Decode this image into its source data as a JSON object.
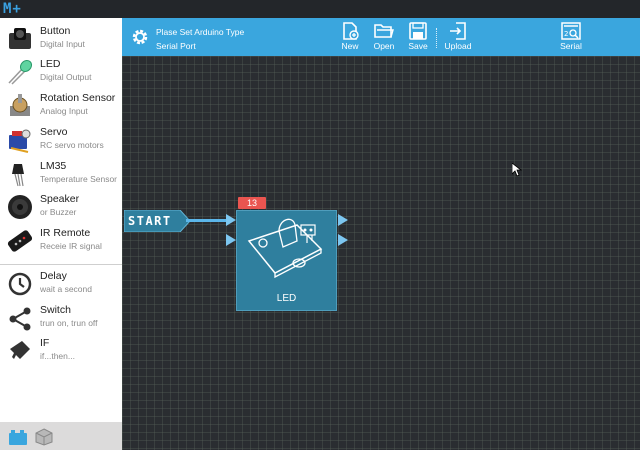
{
  "app": {
    "logo": "M+"
  },
  "sidebar": {
    "components": [
      {
        "name": "Button",
        "sub": "Digital Input",
        "icon": "button-module-icon"
      },
      {
        "name": "LED",
        "sub": "Digital Output",
        "icon": "led-module-icon"
      },
      {
        "name": "Rotation Sensor",
        "sub": "Analog Input",
        "icon": "rotation-sensor-icon"
      },
      {
        "name": "Servo",
        "sub": "RC servo motors",
        "icon": "servo-icon"
      },
      {
        "name": "LM35",
        "sub": "Temperature Sensor",
        "icon": "lm35-icon"
      },
      {
        "name": "Speaker",
        "sub": "or Buzzer",
        "icon": "speaker-icon"
      },
      {
        "name": "IR Remote",
        "sub": "Receie IR signal",
        "icon": "ir-remote-icon"
      }
    ],
    "logic": [
      {
        "name": "Delay",
        "sub": "wait a second",
        "icon": "clock-icon"
      },
      {
        "name": "Switch",
        "sub": "trun on, trun off",
        "icon": "switch-icon"
      },
      {
        "name": "IF",
        "sub": "if...then...",
        "icon": "if-icon"
      }
    ],
    "tabs": [
      {
        "icon": "blocks-tab-icon",
        "active": true
      },
      {
        "icon": "cube-tab-icon",
        "active": false
      }
    ]
  },
  "toolbar": {
    "board_type": "Plase Set Arduino Type",
    "serial_port": "Serial Port",
    "buttons": [
      {
        "label": "New",
        "icon": "new-file-icon"
      },
      {
        "label": "Open",
        "icon": "folder-icon"
      },
      {
        "label": "Save",
        "icon": "save-icon"
      },
      {
        "label": "Upload",
        "icon": "upload-icon"
      },
      {
        "label": "Serial",
        "icon": "serial-monitor-icon"
      }
    ]
  },
  "canvas": {
    "start_label": "START",
    "block": {
      "label": "LED",
      "pin": "13"
    }
  },
  "colors": {
    "toolbar": "#3aa6de",
    "block": "#2f7f9e",
    "badge": "#ea5550",
    "canvas": "#2a2d31"
  }
}
